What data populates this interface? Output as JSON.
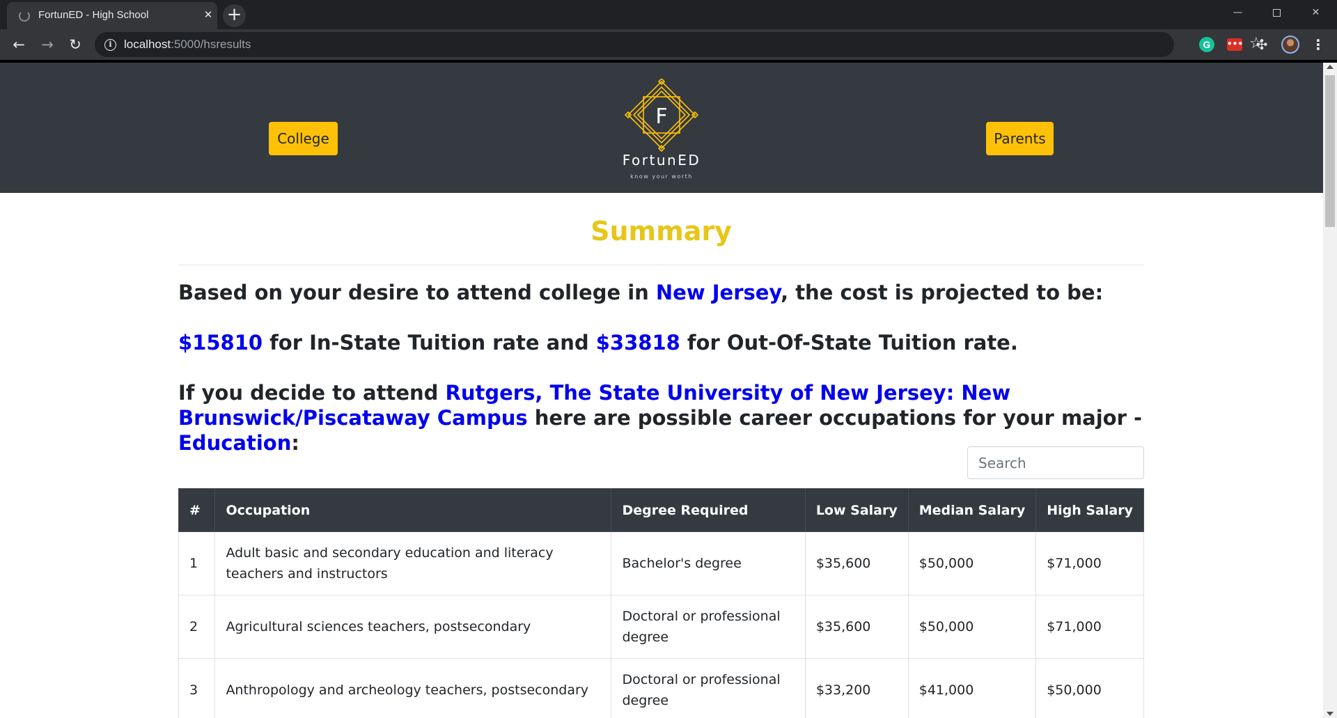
{
  "browser": {
    "tab_title": "FortunED - High School",
    "tab_close": "✕",
    "new_tab": "+",
    "url_host": "localhost",
    "url_path": ":5000/hsresults",
    "window_min": "—",
    "window_close": "✕"
  },
  "header": {
    "college_button": "College",
    "parents_button": "Parents",
    "logo_letter": "F",
    "logo_name": "FortunED",
    "logo_tagline": "know your worth"
  },
  "summary": {
    "title": "Summary",
    "p1_a": "Based on your desire to attend college in ",
    "state": "New Jersey",
    "p1_b": ", the cost is projected to be:",
    "in_state_cost": "$15810",
    "p2_a": " for In-State Tuition rate and ",
    "out_state_cost": "$33818",
    "p2_b": " for Out-Of-State Tuition rate.",
    "p3_a": "If you decide to attend ",
    "university": "Rutgers, The State University of New Jersey: New Brunswick/Piscataway Campus",
    "p3_b": " here are possible career occupations for your major - ",
    "major": "Education",
    "p3_c": ":"
  },
  "search": {
    "placeholder": "Search"
  },
  "table": {
    "headers": [
      "#",
      "Occupation",
      "Degree Required",
      "Low Salary",
      "Median Salary",
      "High Salary"
    ],
    "rows": [
      [
        "1",
        "Adult basic and secondary education and literacy teachers and instructors",
        "Bachelor's degree",
        "$35,600",
        "$50,000",
        "$71,000"
      ],
      [
        "2",
        "Agricultural sciences teachers, postsecondary",
        "Doctoral or professional degree",
        "$35,600",
        "$50,000",
        "$71,000"
      ],
      [
        "3",
        "Anthropology and archeology teachers, postsecondary",
        "Doctoral or professional degree",
        "$33,200",
        "$41,000",
        "$50,000"
      ]
    ]
  },
  "colors": {
    "header_bg": "#343a40",
    "accent_yellow": "#ffc107",
    "title_yellow": "#e6c619",
    "link_blue": "#0000ee"
  }
}
